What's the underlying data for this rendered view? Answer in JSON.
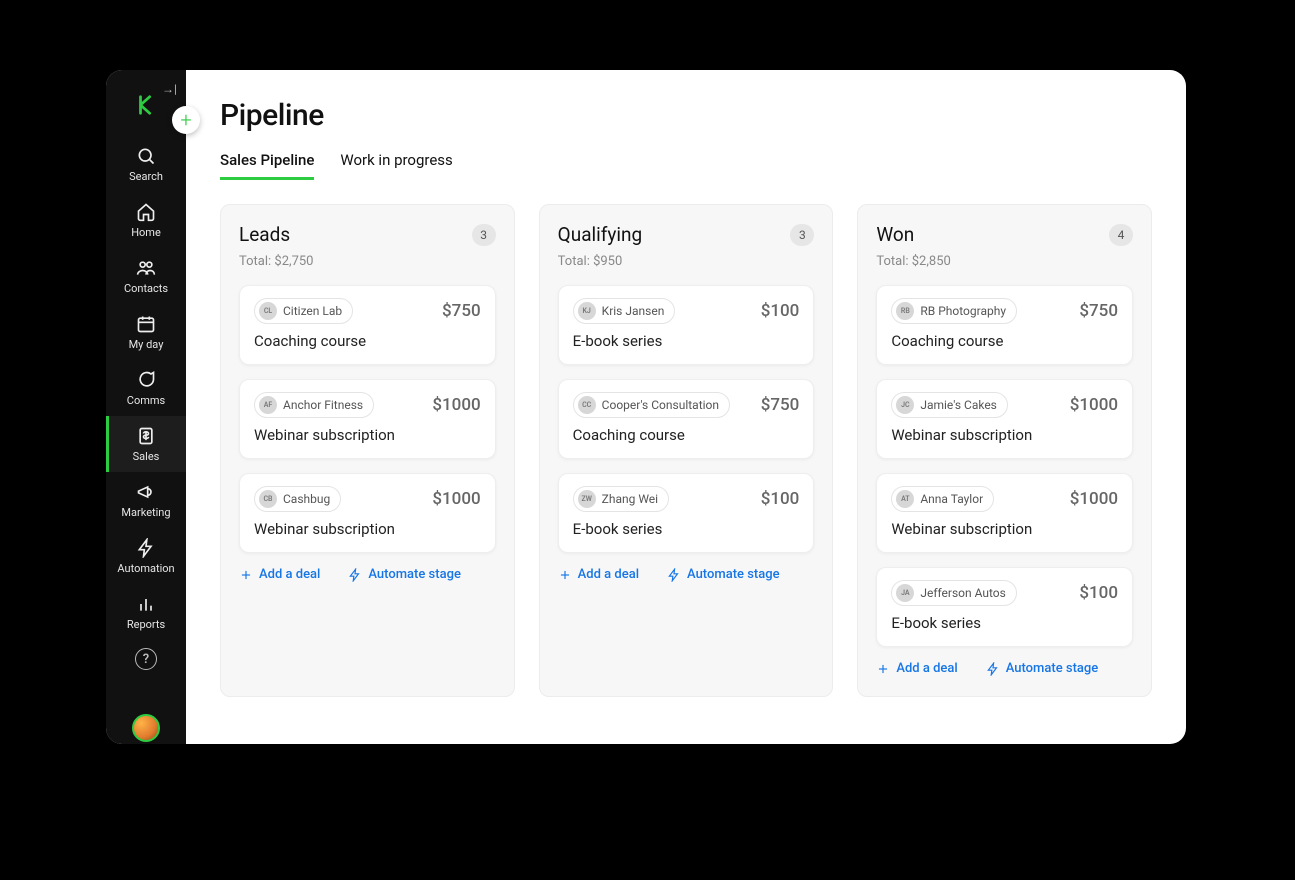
{
  "header": {
    "title": "Pipeline"
  },
  "tabs": [
    {
      "label": "Sales Pipeline",
      "active": true
    },
    {
      "label": "Work in progress",
      "active": false
    }
  ],
  "sidebar": {
    "items": [
      {
        "id": "search",
        "label": "Search",
        "icon": "search-icon"
      },
      {
        "id": "home",
        "label": "Home",
        "icon": "home-icon"
      },
      {
        "id": "contacts",
        "label": "Contacts",
        "icon": "contacts-icon"
      },
      {
        "id": "myday",
        "label": "My day",
        "icon": "calendar-icon"
      },
      {
        "id": "comms",
        "label": "Comms",
        "icon": "chat-icon"
      },
      {
        "id": "sales",
        "label": "Sales",
        "icon": "dollar-icon",
        "active": true
      },
      {
        "id": "marketing",
        "label": "Marketing",
        "icon": "megaphone-icon"
      },
      {
        "id": "automation",
        "label": "Automation",
        "icon": "bolt-icon"
      },
      {
        "id": "reports",
        "label": "Reports",
        "icon": "bar-icon"
      }
    ]
  },
  "actions": {
    "add_deal": "Add a deal",
    "automate_stage": "Automate stage"
  },
  "columns": [
    {
      "title": "Leads",
      "count": "3",
      "total": "Total: $2,750",
      "cards": [
        {
          "contact": "Citizen Lab",
          "initials": "CL",
          "product": "Coaching course",
          "price": "$750"
        },
        {
          "contact": "Anchor Fitness",
          "initials": "AF",
          "product": "Webinar subscription",
          "price": "$1000"
        },
        {
          "contact": "Cashbug",
          "initials": "CB",
          "product": "Webinar subscription",
          "price": "$1000"
        }
      ]
    },
    {
      "title": "Qualifying",
      "count": "3",
      "total": "Total: $950",
      "cards": [
        {
          "contact": "Kris Jansen",
          "initials": "KJ",
          "product": "E-book series",
          "price": "$100"
        },
        {
          "contact": "Cooper's Consultation",
          "initials": "CC",
          "product": "Coaching course",
          "price": "$750"
        },
        {
          "contact": "Zhang Wei",
          "initials": "ZW",
          "product": "E-book series",
          "price": "$100"
        }
      ]
    },
    {
      "title": "Won",
      "count": "4",
      "total": "Total: $2,850",
      "cards": [
        {
          "contact": "RB Photography",
          "initials": "RB",
          "product": "Coaching course",
          "price": "$750"
        },
        {
          "contact": "Jamie's Cakes",
          "initials": "JC",
          "product": "Webinar subscription",
          "price": "$1000"
        },
        {
          "contact": "Anna Taylor",
          "initials": "AT",
          "product": "Webinar subscription",
          "price": "$1000"
        },
        {
          "contact": "Jefferson Autos",
          "initials": "JA",
          "product": "E-book series",
          "price": "$100"
        }
      ]
    }
  ]
}
